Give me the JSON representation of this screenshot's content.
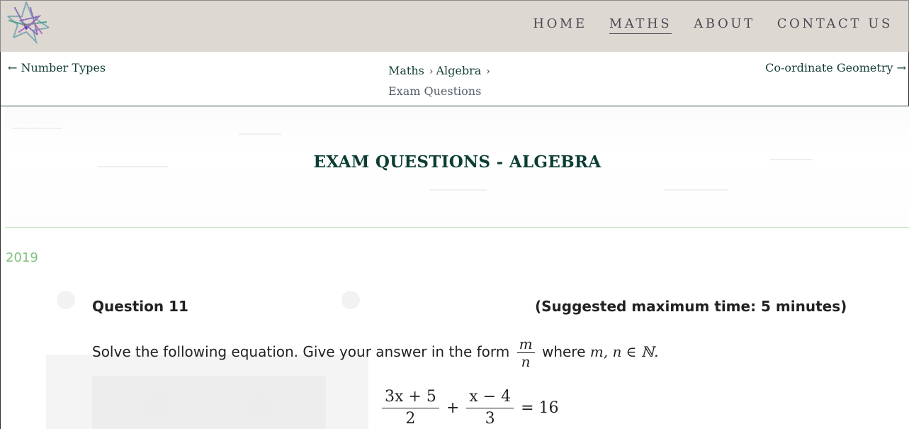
{
  "nav": {
    "items": [
      {
        "label": "HOME",
        "active": false
      },
      {
        "label": "MATHS",
        "active": true
      },
      {
        "label": "ABOUT",
        "active": false
      },
      {
        "label": "CONTACT US",
        "active": false
      }
    ]
  },
  "pager": {
    "prev": "← Number Types",
    "next": "Co-ordinate Geometry →"
  },
  "breadcrumb": {
    "items": [
      "Maths",
      "Algebra"
    ],
    "separator": "›",
    "current": "Exam Questions"
  },
  "page": {
    "title": "EXAM QUESTIONS - ALGEBRA",
    "year": "2019"
  },
  "question": {
    "heading": "Question 11",
    "time": "(Suggested maximum time: 5 minutes)",
    "text_before": "Solve the following equation.  Give your answer in the form",
    "frac_num": "m",
    "frac_den": "n",
    "text_where": "where",
    "text_vars": "m, n ∈ ℕ.",
    "eq_num1": "3x + 5",
    "eq_den1": "2",
    "eq_plus": "+",
    "eq_num2": "x − 4",
    "eq_den2": "3",
    "eq_rhs": "= 16"
  },
  "colors": {
    "header_bg": "#ddd8d2",
    "nav_text": "#4a4a52",
    "link_green": "#123d36",
    "year_green": "#7ec07b",
    "divider": "#b9dcae"
  },
  "icons": {
    "logo": "star-logo-icon"
  }
}
